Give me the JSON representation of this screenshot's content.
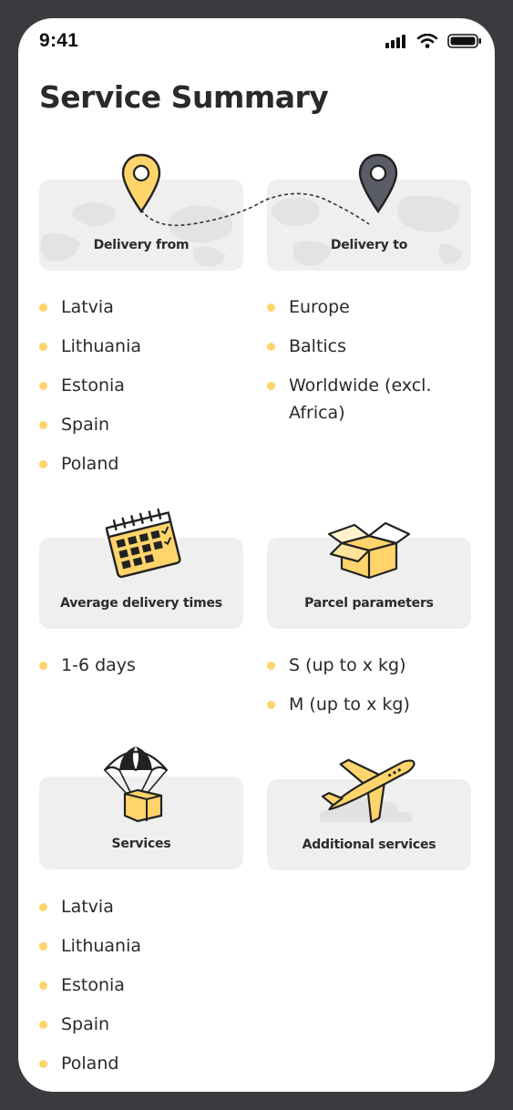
{
  "status_bar": {
    "time": "9:41"
  },
  "page": {
    "title": "Service Summary"
  },
  "cards": {
    "delivery_from": {
      "label": "Delivery from",
      "items": [
        "Latvia",
        "Lithuania",
        "Estonia",
        "Spain",
        "Poland"
      ]
    },
    "delivery_to": {
      "label": "Delivery to",
      "items": [
        "Europe",
        "Baltics",
        "Worldwide (excl. Africa)"
      ]
    },
    "average_delivery_times": {
      "label": "Average delivery times",
      "items": [
        "1-6 days"
      ]
    },
    "parcel_parameters": {
      "label": "Parcel parameters",
      "items": [
        "S (up to x kg)",
        "M (up to x kg)"
      ]
    },
    "services": {
      "label": "Services",
      "items": [
        "Latvia",
        "Lithuania",
        "Estonia",
        "Spain",
        "Poland"
      ]
    },
    "additional_services": {
      "label": "Additional services"
    }
  },
  "icons": {
    "delivery_from": "map-pin-icon",
    "delivery_to": "map-pin-icon",
    "average_delivery_times": "calendar-icon",
    "parcel_parameters": "open-box-icon",
    "services": "parachute-box-icon",
    "additional_services": "airplane-icon"
  },
  "colors": {
    "accent": "#ffd46b",
    "card_background": "#efefef",
    "dark_pin": "#5a5d66",
    "frame": "#3b3b3f"
  }
}
